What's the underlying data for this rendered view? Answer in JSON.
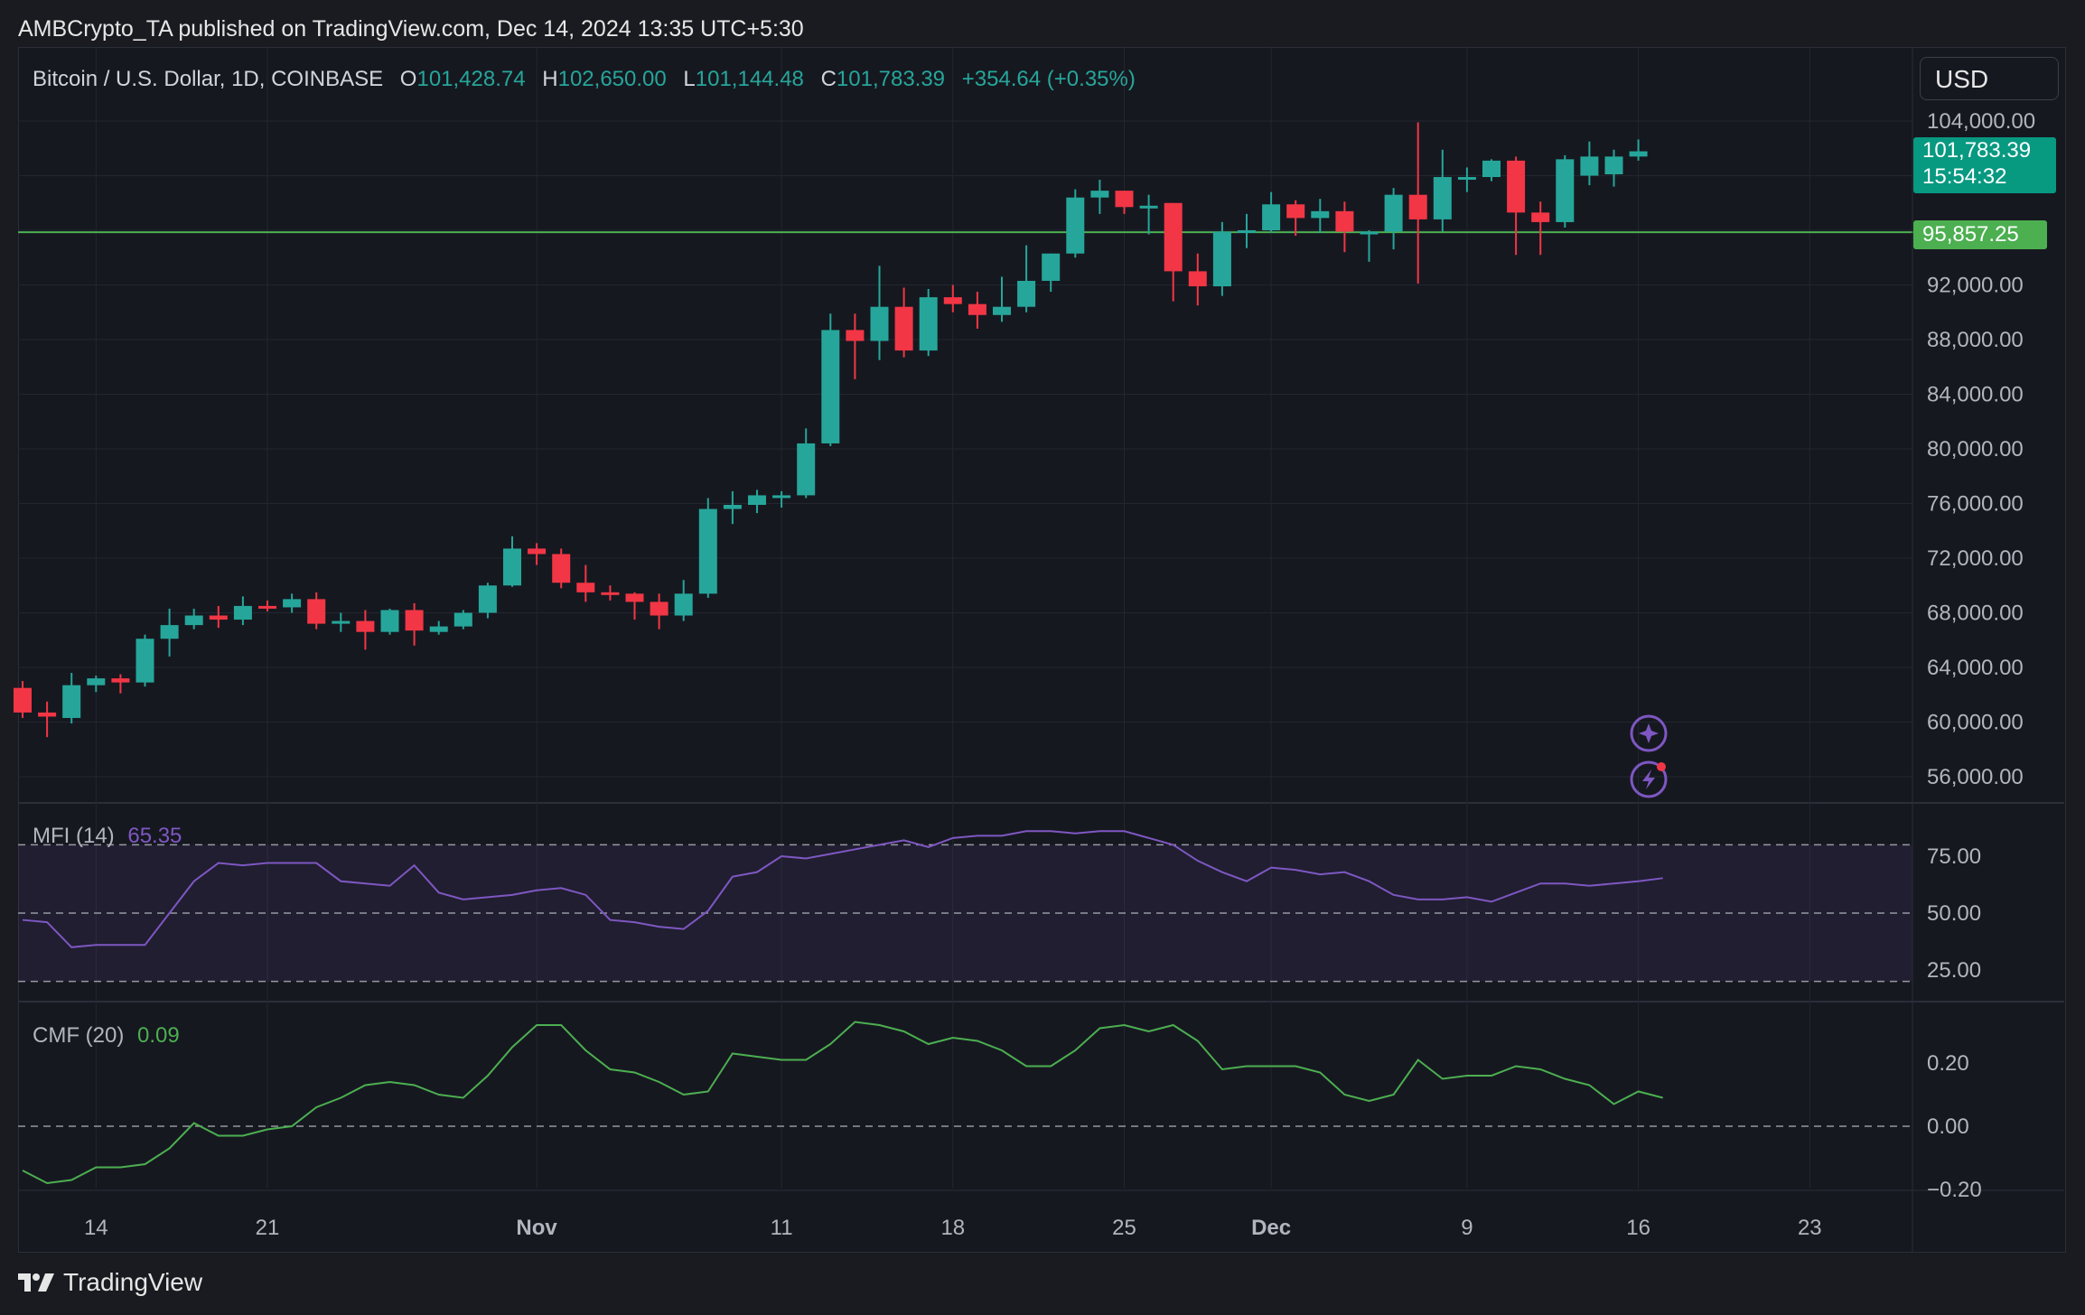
{
  "header": {
    "published": "AMBCrypto_TA published on TradingView.com, Dec 14, 2024 13:35 UTC+5:30"
  },
  "symbol": {
    "title": "Bitcoin / U.S. Dollar, 1D, COINBASE",
    "o_label": "O",
    "o_value": "101,428.74",
    "h_label": "H",
    "h_value": "102,650.00",
    "l_label": "L",
    "l_value": "101,144.48",
    "c_label": "C",
    "c_value": "101,783.39",
    "change": "+354.64 (+0.35%)"
  },
  "currency_button": "USD",
  "price_tags": {
    "last_price": "101,783.39",
    "countdown": "15:54:32",
    "level": "95,857.25"
  },
  "indicators": {
    "mfi_name": "MFI (14)",
    "mfi_value": "65.35",
    "cmf_name": "CMF (20)",
    "cmf_value": "0.09"
  },
  "footer": {
    "brand": "TradingView"
  },
  "colors": {
    "up": "#26a69a",
    "down": "#f23645",
    "mfi_line": "#7e57c2",
    "cmf_line": "#4caf50",
    "level_line": "#4caf50",
    "background": "#161820"
  },
  "icons": [
    "sparkle-icon",
    "lightning-icon",
    "tradingview-logo-icon"
  ],
  "chart_data": [
    {
      "type": "candlestick",
      "title": "Bitcoin / U.S. Dollar, 1D, COINBASE",
      "x_ticks": [
        "14",
        "21",
        "Nov",
        "11",
        "18",
        "25",
        "Dec",
        "9",
        "16",
        "23"
      ],
      "y_ticks": [
        "104,000.00",
        "92,000.00",
        "88,000.00",
        "84,000.00",
        "80,000.00",
        "76,000.00",
        "72,000.00",
        "68,000.00",
        "64,000.00",
        "60,000.00",
        "56,000.00"
      ],
      "ylim": [
        52800,
        105600
      ],
      "horizontal_level": 95857.25,
      "candles": [
        {
          "o": 62500,
          "h": 63000,
          "l": 60300,
          "c": 60700
        },
        {
          "o": 60700,
          "h": 61500,
          "l": 58900,
          "c": 60400
        },
        {
          "o": 60300,
          "h": 63600,
          "l": 59900,
          "c": 62700
        },
        {
          "o": 62700,
          "h": 63400,
          "l": 62200,
          "c": 63200
        },
        {
          "o": 63200,
          "h": 63500,
          "l": 62100,
          "c": 62900
        },
        {
          "o": 62900,
          "h": 66400,
          "l": 62600,
          "c": 66100
        },
        {
          "o": 66100,
          "h": 68300,
          "l": 64800,
          "c": 67100
        },
        {
          "o": 67100,
          "h": 68300,
          "l": 66800,
          "c": 67800
        },
        {
          "o": 67800,
          "h": 68500,
          "l": 66900,
          "c": 67500
        },
        {
          "o": 67500,
          "h": 69200,
          "l": 67100,
          "c": 68500
        },
        {
          "o": 68500,
          "h": 68900,
          "l": 68100,
          "c": 68400
        },
        {
          "o": 68400,
          "h": 69400,
          "l": 68000,
          "c": 69000
        },
        {
          "o": 69000,
          "h": 69500,
          "l": 66800,
          "c": 67200
        },
        {
          "o": 67200,
          "h": 68000,
          "l": 66600,
          "c": 67400
        },
        {
          "o": 67400,
          "h": 68200,
          "l": 65300,
          "c": 66600
        },
        {
          "o": 66600,
          "h": 68300,
          "l": 66400,
          "c": 68200
        },
        {
          "o": 68200,
          "h": 68700,
          "l": 65600,
          "c": 66700
        },
        {
          "o": 66600,
          "h": 67400,
          "l": 66400,
          "c": 67000
        },
        {
          "o": 67000,
          "h": 68200,
          "l": 66800,
          "c": 68000
        },
        {
          "o": 68000,
          "h": 70200,
          "l": 67600,
          "c": 70000
        },
        {
          "o": 70000,
          "h": 73600,
          "l": 69900,
          "c": 72700
        },
        {
          "o": 72700,
          "h": 73100,
          "l": 71500,
          "c": 72300
        },
        {
          "o": 72300,
          "h": 72700,
          "l": 69800,
          "c": 70200
        },
        {
          "o": 70200,
          "h": 71500,
          "l": 68800,
          "c": 69500
        },
        {
          "o": 69500,
          "h": 70000,
          "l": 68900,
          "c": 69400
        },
        {
          "o": 69400,
          "h": 69500,
          "l": 67500,
          "c": 68800
        },
        {
          "o": 68800,
          "h": 69400,
          "l": 66800,
          "c": 67800
        },
        {
          "o": 67800,
          "h": 70400,
          "l": 67400,
          "c": 69400
        },
        {
          "o": 69400,
          "h": 76400,
          "l": 69100,
          "c": 75600
        },
        {
          "o": 75600,
          "h": 76900,
          "l": 74500,
          "c": 75900
        },
        {
          "o": 75900,
          "h": 77000,
          "l": 75300,
          "c": 76600
        },
        {
          "o": 76600,
          "h": 76900,
          "l": 75700,
          "c": 76600
        },
        {
          "o": 76600,
          "h": 81500,
          "l": 76400,
          "c": 80400
        },
        {
          "o": 80400,
          "h": 89900,
          "l": 80200,
          "c": 88700
        },
        {
          "o": 88700,
          "h": 89900,
          "l": 85100,
          "c": 87900
        },
        {
          "o": 87900,
          "h": 93400,
          "l": 86500,
          "c": 90400
        },
        {
          "o": 90400,
          "h": 91800,
          "l": 86700,
          "c": 87200
        },
        {
          "o": 87200,
          "h": 91700,
          "l": 86800,
          "c": 91100
        },
        {
          "o": 91100,
          "h": 92000,
          "l": 90000,
          "c": 90600
        },
        {
          "o": 90600,
          "h": 91500,
          "l": 88800,
          "c": 89800
        },
        {
          "o": 89800,
          "h": 92600,
          "l": 89300,
          "c": 90400
        },
        {
          "o": 90400,
          "h": 94900,
          "l": 90000,
          "c": 92300
        },
        {
          "o": 92300,
          "h": 94300,
          "l": 91500,
          "c": 94300
        },
        {
          "o": 94300,
          "h": 99000,
          "l": 94000,
          "c": 98400
        },
        {
          "o": 98400,
          "h": 99700,
          "l": 97200,
          "c": 98900
        },
        {
          "o": 98900,
          "h": 98900,
          "l": 97200,
          "c": 97700
        },
        {
          "o": 97700,
          "h": 98600,
          "l": 95700,
          "c": 97800
        },
        {
          "o": 98000,
          "h": 98000,
          "l": 90800,
          "c": 93000
        },
        {
          "o": 93000,
          "h": 94300,
          "l": 90500,
          "c": 91900
        },
        {
          "o": 91900,
          "h": 96600,
          "l": 91200,
          "c": 95900
        },
        {
          "o": 95900,
          "h": 97200,
          "l": 94700,
          "c": 96000
        },
        {
          "o": 96000,
          "h": 98800,
          "l": 95800,
          "c": 97900
        },
        {
          "o": 97900,
          "h": 98200,
          "l": 95600,
          "c": 96900
        },
        {
          "o": 96900,
          "h": 98300,
          "l": 95800,
          "c": 97400
        },
        {
          "o": 97400,
          "h": 98100,
          "l": 94400,
          "c": 95900
        },
        {
          "o": 95900,
          "h": 96000,
          "l": 93700,
          "c": 95900
        },
        {
          "o": 95900,
          "h": 99100,
          "l": 94600,
          "c": 98600
        },
        {
          "o": 98600,
          "h": 103900,
          "l": 92100,
          "c": 96800
        },
        {
          "o": 96800,
          "h": 101900,
          "l": 95900,
          "c": 99900
        },
        {
          "o": 99900,
          "h": 100600,
          "l": 98800,
          "c": 99900
        },
        {
          "o": 99900,
          "h": 101200,
          "l": 99600,
          "c": 101100
        },
        {
          "o": 101100,
          "h": 101400,
          "l": 94200,
          "c": 97300
        },
        {
          "o": 97300,
          "h": 98100,
          "l": 94200,
          "c": 96600
        },
        {
          "o": 96600,
          "h": 101500,
          "l": 96200,
          "c": 101200
        },
        {
          "o": 100000,
          "h": 102500,
          "l": 99300,
          "c": 101400
        },
        {
          "o": 100100,
          "h": 101900,
          "l": 99200,
          "c": 101400
        },
        {
          "o": 101400,
          "h": 102650,
          "l": 101100,
          "c": 101783
        }
      ]
    },
    {
      "type": "line",
      "name": "MFI (14)",
      "y_ticks": [
        "75.00",
        "50.00",
        "25.00"
      ],
      "levels": [
        80,
        50,
        20
      ],
      "ylim": [
        15,
        85
      ],
      "values": [
        47,
        46,
        35,
        36,
        36,
        36,
        50,
        64,
        72,
        71,
        72,
        72,
        72,
        64,
        63,
        62,
        71,
        59,
        56,
        57,
        58,
        60,
        61,
        58,
        47,
        46,
        44,
        43,
        51,
        66,
        68,
        75,
        74,
        76,
        78,
        80,
        82,
        79,
        83,
        84,
        84,
        86,
        86,
        85,
        86,
        86,
        83,
        80,
        73,
        68,
        64,
        70,
        69,
        67,
        68,
        64,
        58,
        56,
        56,
        57,
        55,
        59,
        63,
        63,
        62,
        63,
        64,
        65.35
      ]
    },
    {
      "type": "line",
      "name": "CMF (20)",
      "y_ticks": [
        "0.20",
        "0.00",
        "−0.20"
      ],
      "levels": [
        0
      ],
      "ylim": [
        -0.2,
        0.38
      ],
      "values": [
        -0.14,
        -0.18,
        -0.17,
        -0.13,
        -0.13,
        -0.12,
        -0.07,
        0.01,
        -0.03,
        -0.03,
        -0.01,
        0.0,
        0.06,
        0.09,
        0.13,
        0.14,
        0.13,
        0.1,
        0.09,
        0.16,
        0.25,
        0.32,
        0.32,
        0.24,
        0.18,
        0.17,
        0.14,
        0.1,
        0.11,
        0.23,
        0.22,
        0.21,
        0.21,
        0.26,
        0.33,
        0.32,
        0.3,
        0.26,
        0.28,
        0.27,
        0.24,
        0.19,
        0.19,
        0.24,
        0.31,
        0.32,
        0.3,
        0.32,
        0.27,
        0.18,
        0.19,
        0.19,
        0.19,
        0.17,
        0.1,
        0.08,
        0.1,
        0.21,
        0.15,
        0.16,
        0.16,
        0.19,
        0.18,
        0.15,
        0.13,
        0.07,
        0.11,
        0.09
      ]
    }
  ]
}
